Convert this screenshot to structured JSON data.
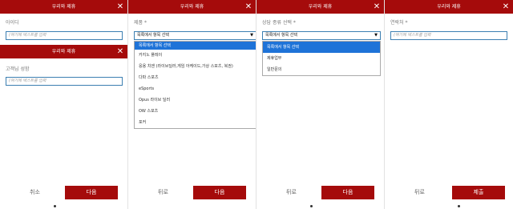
{
  "panels": [
    {
      "header": "우리와 제휴",
      "field1": {
        "label": "아이디",
        "placeholder": "(여기에 텍스트를 입력"
      },
      "header2": "우리와 제휴",
      "field2": {
        "label": "고객님 성함",
        "placeholder": "(여기에 텍스트를 입력"
      },
      "back": "취소",
      "next": "다음"
    },
    {
      "header": "우리와 제휴",
      "label": "제품 *",
      "selected": "목록에서 항목 선택",
      "options": [
        "목록에서 항목 선택",
        "카지노 플레이",
        "응용 치엔 (라이브딜러,게임 아케이드,가상 스포츠, 복권)",
        "다파 스포츠",
        "eSports",
        "Opus 라이브 딜러",
        "OW 스포츠",
        "포커"
      ],
      "back": "뒤로",
      "next": "다음"
    },
    {
      "header": "우리와 제휴",
      "label": "상담 종류 선택 *",
      "selected": "목록에서 항목 선택",
      "options": [
        "목록에서 항목 선택",
        "제휴업무",
        "일반문의"
      ],
      "back": "뒤로",
      "next": "다음"
    },
    {
      "header": "우리와 제휴",
      "label": "연락처 *",
      "placeholder": "(여기에 텍스트를 입력",
      "back": "뒤로",
      "next": "제출"
    }
  ],
  "icons": {
    "close": "close-icon",
    "caret": "chevron-down-icon"
  },
  "colors": {
    "brand": "#a50b0b",
    "focus": "#3c7fb1",
    "highlight": "#1e73d8"
  }
}
